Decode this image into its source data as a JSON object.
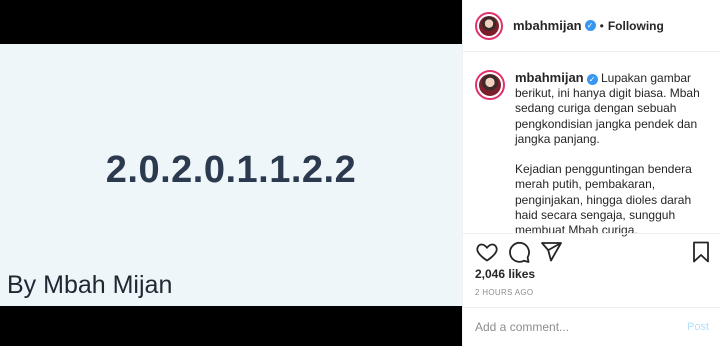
{
  "media": {
    "code_text": "2.0.2.0.1.1.2.2",
    "credit_text": "By Mbah Mijan",
    "background_color": "#eff6f9",
    "letterbox_color": "#000000"
  },
  "header": {
    "username": "mbahmijan",
    "verified": true,
    "separator": "•",
    "follow_state": "Following"
  },
  "caption": {
    "username": "mbahmijan",
    "text": "Lupakan gambar berikut, ini hanya digit biasa. Mbah sedang curiga dengan sebuah pengkondisian jangka pendek dan jangka panjang.\n\nKejadian pengguntingan bendera merah putih, pembakaran, penginjakan, hingga dioles darah haid secara sengaja, sungguh membuat Mbah curiga."
  },
  "actions": {
    "icons": [
      "heart-icon",
      "comment-icon",
      "share-icon",
      "bookmark-icon"
    ]
  },
  "likes": "2,046 likes",
  "timestamp": "2 HOURS AGO",
  "comment": {
    "placeholder": "Add a comment...",
    "post_label": "Post"
  },
  "colors": {
    "verified_badge": "#3897f0",
    "post_button_disabled": "#b2dffc",
    "code_text": "#2b3a4e"
  }
}
